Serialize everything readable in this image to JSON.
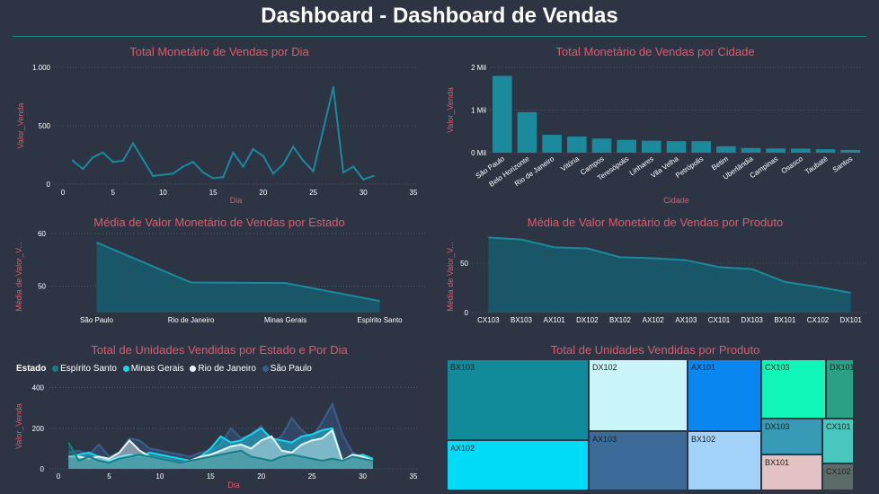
{
  "page": {
    "title": "Dashboard - Dashboard de Vendas",
    "background": "#2d3444"
  },
  "colors": {
    "accent": "#1a8a9c",
    "title_red": "#e05a6a"
  },
  "chart_data": [
    {
      "id": "vendas_dia",
      "type": "line",
      "title": "Total Monetário de Vendas por Dia",
      "xlabel": "Dia",
      "ylabel": "Valor_Venda",
      "xlim": [
        0,
        35
      ],
      "ylim": [
        0,
        1000
      ],
      "xticks": [
        0,
        5,
        10,
        15,
        20,
        25,
        30,
        35
      ],
      "yticks": [
        0,
        500,
        1000
      ],
      "ytick_labels": [
        "0",
        "500",
        "1.000"
      ],
      "color": "#1a8a9c",
      "x": [
        1,
        2,
        3,
        4,
        5,
        6,
        7,
        8,
        9,
        10,
        11,
        12,
        13,
        14,
        15,
        16,
        17,
        18,
        19,
        20,
        21,
        22,
        23,
        24,
        25,
        26,
        27,
        28,
        29,
        30,
        31
      ],
      "y": [
        200,
        130,
        230,
        270,
        190,
        200,
        350,
        210,
        70,
        80,
        90,
        150,
        190,
        100,
        50,
        60,
        270,
        150,
        300,
        240,
        90,
        170,
        320,
        200,
        110,
        470,
        830,
        100,
        150,
        40,
        70
      ]
    },
    {
      "id": "vendas_cidade",
      "type": "bar",
      "title": "Total Monetário de Vendas por Cidade",
      "xlabel": "Cidade",
      "ylabel": "Valor_Venda",
      "ylim": [
        0,
        2000
      ],
      "yticks": [
        0,
        1000,
        2000
      ],
      "ytick_labels": [
        "0 Mil",
        "1 Mil",
        "2 Mil"
      ],
      "color": "#1a8a9c",
      "categories": [
        "São Paulo",
        "Belo Horizonte",
        "Rio de Janeiro",
        "Vitória",
        "Campos",
        "Teresópolis",
        "Linhares",
        "Vila Velha",
        "Petrópolis",
        "Betim",
        "Uberlândia",
        "Campinas",
        "Osasco",
        "Taubaté",
        "Santos"
      ],
      "values": [
        1800,
        950,
        420,
        380,
        330,
        300,
        280,
        270,
        270,
        150,
        110,
        100,
        95,
        80,
        65
      ]
    },
    {
      "id": "media_estado",
      "type": "area",
      "title": "Média de Valor Monetário de Vendas por Estado",
      "ylabel": "Média de Valor_V...",
      "ylim": [
        45,
        60
      ],
      "yticks": [
        50,
        60
      ],
      "ytick_labels": [
        "50",
        "60"
      ],
      "color": "#1a8a9c",
      "categories": [
        "São Paulo",
        "Rio de Janeiro",
        "Minas Gerais",
        "Espírito Santo"
      ],
      "values": [
        58.3,
        50.7,
        50.6,
        47.2
      ]
    },
    {
      "id": "media_produto",
      "type": "area",
      "title": "Média de Valor Monetário de Vendas por Produto",
      "ylabel": "Média de Valor_V...",
      "ylim": [
        0,
        80
      ],
      "yticks": [
        0,
        50
      ],
      "ytick_labels": [
        "0",
        "50"
      ],
      "color": "#1a8a9c",
      "categories": [
        "CX103",
        "BX103",
        "AX101",
        "DX102",
        "BX102",
        "AX102",
        "AX103",
        "CX101",
        "DX103",
        "BX101",
        "CX102",
        "DX101"
      ],
      "values": [
        76,
        74,
        66,
        65,
        56,
        55,
        53,
        46,
        44,
        31,
        26,
        20
      ]
    },
    {
      "id": "unidades_estado_dia",
      "type": "area",
      "title": "Total de Unidades Vendidas por Estado e Por Dia",
      "xlabel": "Dia",
      "ylabel": "Valor_Venda",
      "legend_title": "Estado",
      "xlim": [
        0,
        35
      ],
      "ylim": [
        0,
        420
      ],
      "xticks": [
        0,
        5,
        10,
        15,
        20,
        25,
        30,
        35
      ],
      "yticks": [
        0,
        200,
        400
      ],
      "ytick_labels": [
        "0",
        "200",
        "400"
      ],
      "x": [
        1,
        2,
        3,
        4,
        5,
        6,
        7,
        8,
        9,
        10,
        11,
        12,
        13,
        14,
        15,
        16,
        17,
        18,
        19,
        20,
        21,
        22,
        23,
        24,
        25,
        26,
        27,
        28,
        29,
        30,
        31
      ],
      "series": [
        {
          "name": "Espírito Santo",
          "color": "#137f86",
          "values": [
            130,
            40,
            60,
            40,
            30,
            50,
            60,
            70,
            60,
            50,
            40,
            30,
            40,
            50,
            60,
            70,
            80,
            90,
            60,
            50,
            40,
            60,
            70,
            60,
            50,
            40,
            50,
            40,
            60,
            50,
            40
          ]
        },
        {
          "name": "Minas Gerais",
          "color": "#18d5f0",
          "values": [
            60,
            70,
            80,
            60,
            40,
            60,
            70,
            60,
            80,
            70,
            60,
            50,
            40,
            60,
            100,
            160,
            130,
            140,
            170,
            200,
            150,
            140,
            130,
            160,
            170,
            190,
            200,
            40,
            60,
            70,
            50
          ]
        },
        {
          "name": "Rio de Janeiro",
          "color": "#e8f6f8",
          "values": [
            60,
            60,
            50,
            60,
            50,
            80,
            140,
            90,
            60,
            50,
            40,
            30,
            40,
            60,
            70,
            90,
            110,
            120,
            100,
            140,
            160,
            90,
            80,
            120,
            140,
            150,
            190,
            40,
            70,
            60,
            40
          ]
        },
        {
          "name": "São Paulo",
          "color": "#3a5e8c",
          "values": [
            80,
            90,
            70,
            120,
            60,
            80,
            150,
            140,
            100,
            90,
            80,
            70,
            60,
            80,
            90,
            120,
            200,
            150,
            170,
            210,
            130,
            160,
            250,
            190,
            150,
            230,
            320,
            170,
            80,
            60,
            50
          ]
        }
      ]
    },
    {
      "id": "unidades_produto",
      "type": "treemap",
      "title": "Total de Unidades Vendidas por Produto",
      "items": [
        {
          "label": "BX103",
          "color": "#118a9a"
        },
        {
          "label": "AX102",
          "color": "#00dcf8"
        },
        {
          "label": "DX102",
          "color": "#c9f4f8"
        },
        {
          "label": "AX103",
          "color": "#3d6b99"
        },
        {
          "label": "AX101",
          "color": "#0a86f0"
        },
        {
          "label": "BX102",
          "color": "#a3d2f8"
        },
        {
          "label": "CX103",
          "color": "#10f6b8"
        },
        {
          "label": "DX101",
          "color": "#2aa184"
        },
        {
          "label": "DX103",
          "color": "#379ab6"
        },
        {
          "label": "CX101",
          "color": "#4ac7bd"
        },
        {
          "label": "BX101",
          "color": "#e2c2c2"
        },
        {
          "label": "CX102",
          "color": "#5c6a6a"
        }
      ]
    }
  ]
}
